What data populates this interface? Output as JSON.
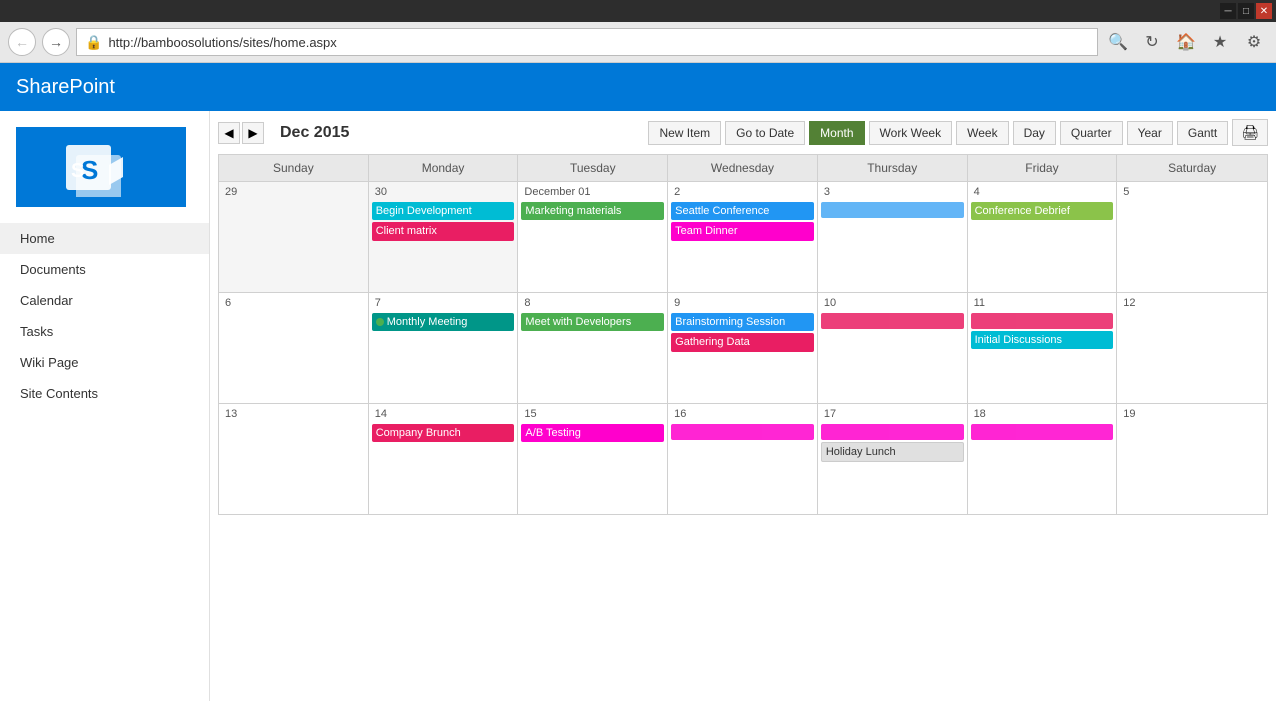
{
  "window": {
    "min_label": "─",
    "max_label": "□",
    "close_label": "✕"
  },
  "browser": {
    "url": "http://bamboosolutions/sites/home.aspx",
    "back_title": "Back",
    "forward_title": "Forward",
    "refresh_title": "Refresh",
    "home_title": "Home",
    "favorites_title": "Favorites",
    "settings_title": "Settings"
  },
  "sharepoint": {
    "title": "SharePoint"
  },
  "sidebar": {
    "logo_alt": "SharePoint Logo",
    "items": [
      {
        "label": "Home",
        "active": true
      },
      {
        "label": "Documents",
        "active": false
      },
      {
        "label": "Calendar",
        "active": false
      },
      {
        "label": "Tasks",
        "active": false
      },
      {
        "label": "Wiki Page",
        "active": false
      },
      {
        "label": "Site Contents",
        "active": false
      }
    ]
  },
  "calendar": {
    "title": "Dec 2015",
    "new_item": "New Item",
    "go_to_date": "Go to Date",
    "views": [
      "Month",
      "Work Week",
      "Week",
      "Day",
      "Quarter",
      "Year",
      "Gantt"
    ],
    "active_view": "Month",
    "print_icon": "🖨",
    "days": [
      "Sunday",
      "Monday",
      "Tuesday",
      "Wednesday",
      "Thursday",
      "Friday",
      "Saturday"
    ],
    "weeks": [
      {
        "cells": [
          {
            "date": "29",
            "other": true,
            "events": []
          },
          {
            "date": "30",
            "other": true,
            "events": [
              {
                "label": "Begin Development",
                "color": "cyan"
              },
              {
                "label": "Client matrix",
                "color": "pink"
              }
            ]
          },
          {
            "date": "December 01",
            "other": false,
            "events": [
              {
                "label": "Marketing materials",
                "color": "green"
              }
            ]
          },
          {
            "date": "2",
            "other": false,
            "events": [
              {
                "label": "Seattle Conference",
                "color": "blue",
                "span": 2
              },
              {
                "label": "Team Dinner",
                "color": "magenta"
              }
            ]
          },
          {
            "date": "3",
            "other": false,
            "events": []
          },
          {
            "date": "4",
            "other": false,
            "events": [
              {
                "label": "Conference Debrief",
                "color": "lime"
              }
            ]
          },
          {
            "date": "5",
            "other": false,
            "events": []
          }
        ]
      },
      {
        "cells": [
          {
            "date": "6",
            "other": false,
            "events": []
          },
          {
            "date": "7",
            "other": false,
            "events": [
              {
                "label": "Monthly Meeting",
                "color": "teal",
                "dot": true
              }
            ]
          },
          {
            "date": "8",
            "other": false,
            "events": [
              {
                "label": "Meet with Developers",
                "color": "green"
              }
            ]
          },
          {
            "date": "9",
            "other": false,
            "events": [
              {
                "label": "Brainstorming Session",
                "color": "blue"
              },
              {
                "label": "Gathering Data",
                "color": "pink",
                "span": 3
              }
            ]
          },
          {
            "date": "10",
            "other": false,
            "events": []
          },
          {
            "date": "11",
            "other": false,
            "events": [
              {
                "label": "Initial Discussions",
                "color": "cyan"
              }
            ]
          },
          {
            "date": "12",
            "other": false,
            "events": []
          }
        ]
      },
      {
        "cells": [
          {
            "date": "13",
            "other": false,
            "events": []
          },
          {
            "date": "14",
            "other": false,
            "events": [
              {
                "label": "Company Brunch",
                "color": "pink"
              }
            ]
          },
          {
            "date": "15",
            "other": false,
            "events": [
              {
                "label": "A/B Testing",
                "color": "magenta",
                "span": 4
              }
            ]
          },
          {
            "date": "16",
            "other": false,
            "events": []
          },
          {
            "date": "17",
            "other": false,
            "events": [
              {
                "label": "Holiday Lunch",
                "color": "grey"
              }
            ]
          },
          {
            "date": "18",
            "other": false,
            "events": []
          },
          {
            "date": "19",
            "other": false,
            "events": []
          }
        ]
      }
    ]
  }
}
